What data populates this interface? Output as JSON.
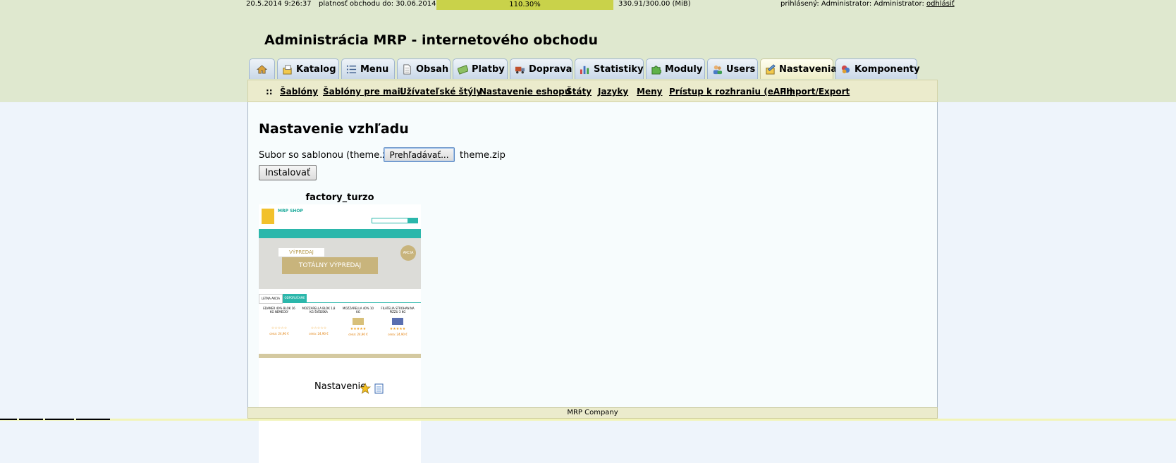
{
  "status": {
    "datetime": "20.5.2014 9:26:37",
    "validity": "platnosť obchodu do: 30.06.2014",
    "progress_label": "110.30%",
    "progress_value": 110.3,
    "storage": "330.91/300.00 (MiB)",
    "user_prefix": "prihlásený: Administrator: Administrator:",
    "logout": "odhlásiť"
  },
  "header": {
    "title": "Administrácia MRP - internetového obchodu"
  },
  "tabs": [
    {
      "label": "",
      "icon": "home-icon"
    },
    {
      "label": "Katalog",
      "icon": "catalog-icon"
    },
    {
      "label": "Menu",
      "icon": "list-icon"
    },
    {
      "label": "Obsah",
      "icon": "document-icon"
    },
    {
      "label": "Platby",
      "icon": "payment-icon"
    },
    {
      "label": "Doprava",
      "icon": "truck-icon"
    },
    {
      "label": "Statistiky",
      "icon": "bar-chart-icon"
    },
    {
      "label": "Moduly",
      "icon": "puzzle-icon"
    },
    {
      "label": "Users",
      "icon": "users-icon"
    },
    {
      "label": "Nastavenia",
      "icon": "settings-icon",
      "active": true
    },
    {
      "label": "Komponenty",
      "icon": "components-icon"
    }
  ],
  "submenu": {
    "separator": "::",
    "items": [
      "Šablóny",
      "Šablóny pre mail",
      "Užívateľské štýly",
      "Nastavenie eshopu",
      "Štáty",
      "Jazyky",
      "Meny",
      "Prístup k rozhraniu (eAPI)",
      "Import/Export"
    ]
  },
  "main": {
    "title": "Nastavenie vzhľadu",
    "file_label": "Subor so sablonou (theme.zip):",
    "browse_button": "Prehľadávať...",
    "file_name": "theme.zip",
    "install_button": "Instalovať",
    "theme": {
      "name": "factory_turzo",
      "preview": {
        "shop_name": "MRP SHOP",
        "banner_small": "VÝPREDAJ",
        "banner_big": "TOTÁLNY VÝPREDAJ",
        "badge": "AKCIA",
        "tab1": "LETNA AKCIA",
        "tab2": "ODPORUČAME",
        "products": [
          {
            "name": "EDAMER 40% BLOK 16 KG NEMECKY",
            "price": "cena: 24,90 €"
          },
          {
            "name": "MOZZARELLA BLOK 1,8 KG ŠVÉDSKA",
            "price": "cena: 24,90 €"
          },
          {
            "name": "MOZZARELLA 40% 10 KG",
            "price": "cena: 24,90 €"
          },
          {
            "name": "FILATELIA STROHAN NA PIZZU 3 KG",
            "price": "cena: 24,90 €"
          }
        ]
      }
    },
    "settings_label": "Nastavenie"
  },
  "footer": {
    "text": "MRP Company"
  },
  "colors": {
    "top_band": "#dfe8cf",
    "progress": "#c9d24a",
    "submenu": "#ebebcc",
    "content": "#f7fcfd",
    "tab": "#c9d8e8"
  }
}
